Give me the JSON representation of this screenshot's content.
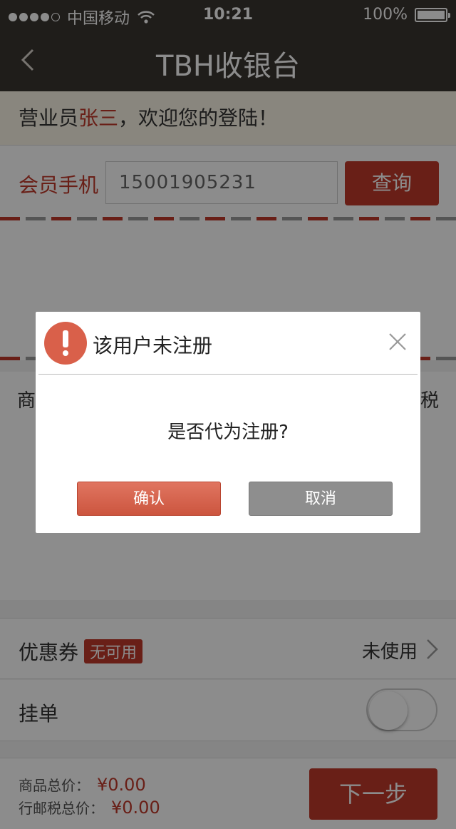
{
  "status_bar": {
    "carrier": "中国移动",
    "time": "10:21",
    "battery": "100%",
    "signal_bars": 4,
    "battery_level": 1.0
  },
  "nav": {
    "title": "TBH收银台",
    "back_icon": "chevron-left-icon"
  },
  "welcome": {
    "prefix": "营业员",
    "name": "张三",
    "suffix": "，欢迎您的登陆！"
  },
  "member": {
    "label": "会员手机",
    "phone": "15001905231",
    "query_label": "查询"
  },
  "items": {
    "left_header": "商",
    "right_header": "税"
  },
  "coupon": {
    "label": "优惠券",
    "badge": "无可用",
    "status": "未使用"
  },
  "hold": {
    "label": "挂单",
    "enabled": false
  },
  "footer": {
    "goods_total_label": "商品总价：",
    "goods_total": "¥0.00",
    "tax_total_label": "行邮税总价：",
    "tax_total": "¥0.00",
    "next_label": "下一步"
  },
  "dialog": {
    "title": "该用户未注册",
    "message": "是否代为注册?",
    "confirm_label": "确认",
    "cancel_label": "取消"
  },
  "colors": {
    "accent": "#c0392b",
    "header_bg": "#3a3530",
    "warning": "#d9604a"
  }
}
